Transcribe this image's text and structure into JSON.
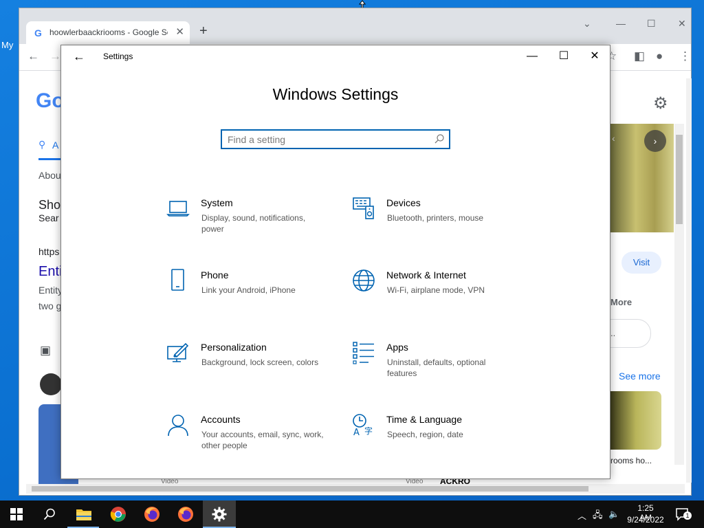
{
  "desktop": {
    "label": "My"
  },
  "chrome": {
    "tab_title": "hoowlerbaackriooms - Google Search",
    "new_tab": "+",
    "google_partial": {
      "logo": "Go",
      "search_tab": "A",
      "about": "About",
      "heading1": "Sho",
      "heading2": "Sear",
      "url_fragment": "https",
      "link_fragment": "Enti",
      "desc1": "Entity",
      "desc2": "two g",
      "visit": "Visit",
      "more": "More",
      "see_more": "See more",
      "thumb_caption": "rooms ho...",
      "pill_text": "..",
      "video1": "Video",
      "video2": "Video",
      "thumb_text": "ACKRO"
    }
  },
  "settings": {
    "window_title": "Settings",
    "heading": "Windows Settings",
    "search_placeholder": "Find a setting",
    "tiles": [
      {
        "title": "System",
        "desc": "Display, sound, notifications, power",
        "icon": "laptop-icon"
      },
      {
        "title": "Devices",
        "desc": "Bluetooth, printers, mouse",
        "icon": "devices-icon"
      },
      {
        "title": "Phone",
        "desc": "Link your Android, iPhone",
        "icon": "phone-icon"
      },
      {
        "title": "Network & Internet",
        "desc": "Wi-Fi, airplane mode, VPN",
        "icon": "globe-icon"
      },
      {
        "title": "Personalization",
        "desc": "Background, lock screen, colors",
        "icon": "personalization-icon"
      },
      {
        "title": "Apps",
        "desc": "Uninstall, defaults, optional features",
        "icon": "apps-icon"
      },
      {
        "title": "Accounts",
        "desc": "Your accounts, email, sync, work, other people",
        "icon": "person-icon"
      },
      {
        "title": "Time & Language",
        "desc": "Speech, region, date",
        "icon": "time-language-icon"
      }
    ]
  },
  "taskbar": {
    "time": "1:25 AM",
    "date": "9/24/2022",
    "notification_count": "1"
  },
  "colors": {
    "accent": "#0063b1",
    "taskbar": "#0e0e0e"
  }
}
